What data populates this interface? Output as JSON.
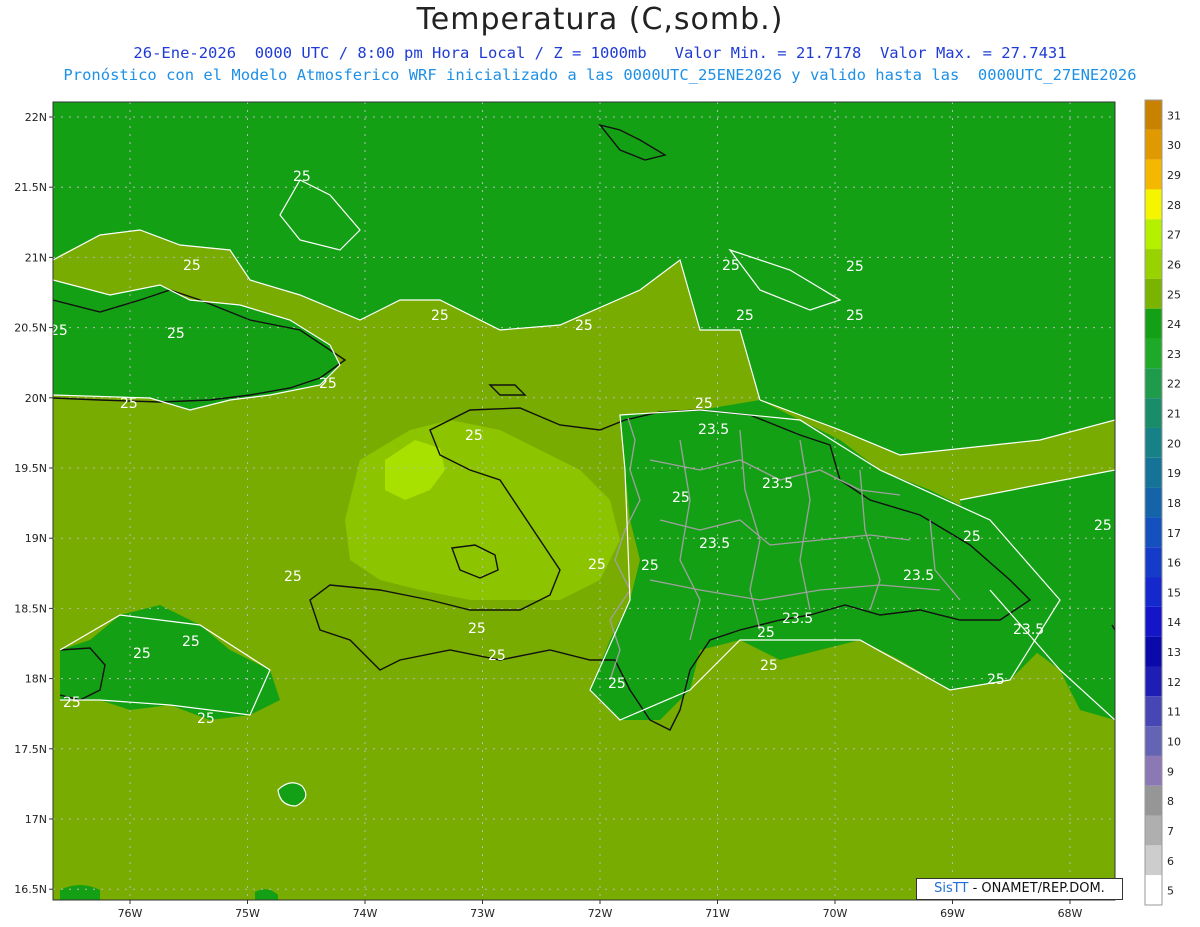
{
  "header": {
    "title": "Temperatura (C,somb.)",
    "line1": "26-Ene-2026  0000 UTC / 8:00 pm Hora Local / Z = 1000mb   Valor Min. = 21.7178  Valor Max. = 27.7431",
    "line2": "Pronóstico con el Modelo Atmosferico WRF inicializado a las 0000UTC_25ENE2026 y valido hasta las  0000UTC_27ENE2026"
  },
  "axes": {
    "lat_labels": [
      "22N",
      "21.5N",
      "21N",
      "20.5N",
      "20N",
      "19.5N",
      "19N",
      "18.5N",
      "18N",
      "17.5N",
      "17N",
      "16.5N"
    ],
    "lon_labels": [
      "76W",
      "75W",
      "74W",
      "73W",
      "72W",
      "71W",
      "70W",
      "69W",
      "68W"
    ]
  },
  "colorbar": {
    "levels": [
      "31",
      "30",
      "29",
      "28",
      "27",
      "26",
      "25",
      "24",
      "23",
      "22",
      "21",
      "20",
      "19",
      "18",
      "17",
      "16",
      "15",
      "14",
      "13",
      "12",
      "11",
      "10",
      "9",
      "8",
      "7",
      "6",
      "5"
    ],
    "colors": [
      "#c88200",
      "#e09a00",
      "#f5b800",
      "#f5f500",
      "#b4f000",
      "#98d200",
      "#78b400",
      "#14a014",
      "#1eaa28",
      "#1e9b4b",
      "#198c69",
      "#168287",
      "#147396",
      "#1464aa",
      "#1450be",
      "#143cc8",
      "#1428cd",
      "#1414c8",
      "#0a0aaa",
      "#1e1eb4",
      "#4646b4",
      "#6464b4",
      "#8c78b4",
      "#969696",
      "#afafaf",
      "#cdcdcd",
      "#ffffff"
    ]
  },
  "colors": {
    "sea_base": "#78ac00",
    "land_warm": "#8cc400",
    "land_hot": "#a8e000",
    "cool_zone": "#14a014",
    "coast": "#111111",
    "border": "#a0a0a0",
    "contour": "#ffffff"
  },
  "contour_labels": [
    "25",
    "25",
    "25",
    "25",
    "25",
    "25",
    "25",
    "25",
    "25",
    "25",
    "25",
    "25",
    "25",
    "25",
    "25",
    "25",
    "25",
    "25",
    "25",
    "25",
    "25",
    "25",
    "25",
    "25",
    "25",
    "25",
    "25",
    "23.5",
    "23.5",
    "23.5",
    "23.5",
    "23.5",
    "23.5"
  ],
  "credit": {
    "sis": "SisTT",
    "text": " - ONAMET/REP.DOM."
  }
}
